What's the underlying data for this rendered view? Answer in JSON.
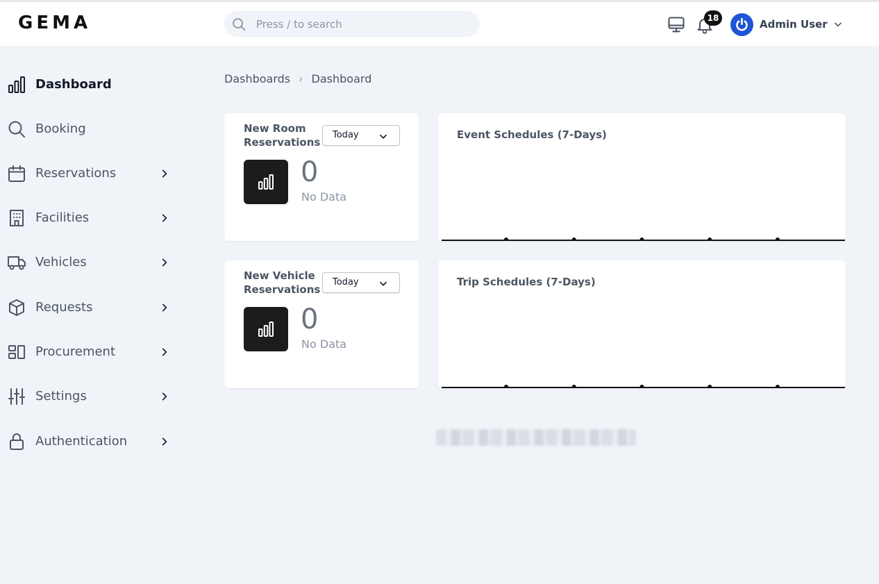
{
  "header": {
    "logo": "GEMA",
    "search_placeholder": "Press / to search",
    "notification_count": "18",
    "user_name": "Admin User"
  },
  "sidebar": {
    "items": [
      {
        "label": "Dashboard",
        "icon": "bar-chart-icon",
        "active": true,
        "has_children": false
      },
      {
        "label": "Booking",
        "icon": "search-icon",
        "active": false,
        "has_children": false
      },
      {
        "label": "Reservations",
        "icon": "calendar-icon",
        "active": false,
        "has_children": true
      },
      {
        "label": "Facilities",
        "icon": "building-icon",
        "active": false,
        "has_children": true
      },
      {
        "label": "Vehicles",
        "icon": "truck-icon",
        "active": false,
        "has_children": true
      },
      {
        "label": "Requests",
        "icon": "box-icon",
        "active": false,
        "has_children": true
      },
      {
        "label": "Procurement",
        "icon": "layout-icon",
        "active": false,
        "has_children": true
      },
      {
        "label": "Settings",
        "icon": "sliders-icon",
        "active": false,
        "has_children": true
      },
      {
        "label": "Authentication",
        "icon": "lock-icon",
        "active": false,
        "has_children": true
      }
    ]
  },
  "breadcrumb": {
    "items": [
      "Dashboards",
      "Dashboard"
    ],
    "separator": "›"
  },
  "stats": [
    {
      "title": "New Room Reservations",
      "period": "Today",
      "value": "0",
      "note": "No Data"
    },
    {
      "title": "New Vehicle Reservations",
      "period": "Today",
      "value": "0",
      "note": "No Data"
    }
  ],
  "charts": [
    {
      "title": "Event Schedules (7-Days)",
      "points": 5
    },
    {
      "title": "Trip Schedules (7-Days)",
      "points": 5
    }
  ],
  "colors": {
    "accent": "#1e55d6",
    "page_bg": "#f0f3f8",
    "dark_tile": "#1c1c1c"
  }
}
